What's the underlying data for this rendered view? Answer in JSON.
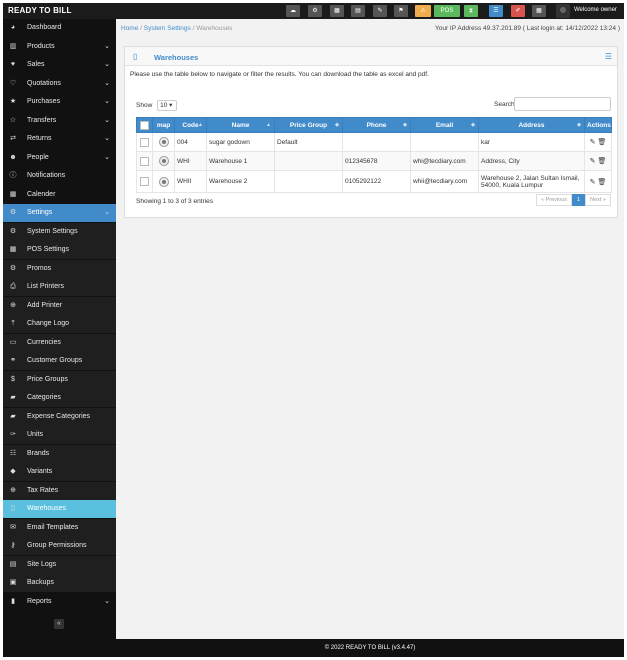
{
  "app": {
    "brand": "READY TO BILL"
  },
  "topbar": {
    "pos_label": "POS",
    "welcome": "Welcome owner",
    "buttons": [
      {
        "icon": "cloud-icon",
        "color": "#555555",
        "glyph": "☁"
      },
      {
        "icon": "gears-icon",
        "color": "#555555",
        "glyph": "⚙"
      },
      {
        "icon": "calculator-icon",
        "color": "#555555",
        "glyph": "▦"
      },
      {
        "icon": "calendar-icon",
        "color": "#555555",
        "glyph": "▤"
      },
      {
        "icon": "note-icon",
        "color": "#555555",
        "glyph": "✎"
      },
      {
        "icon": "flag-icon",
        "color": "#555555",
        "glyph": "⚑"
      },
      {
        "icon": "alert-icon",
        "color": "#f0ad4e",
        "glyph": "⚠"
      },
      {
        "icon": "hourglass-icon",
        "color": "#5cb85c",
        "glyph": "⧗"
      },
      {
        "icon": "list-icon",
        "color": "#428bca",
        "glyph": "☰"
      },
      {
        "icon": "eraser-icon",
        "color": "#d9534f",
        "glyph": "✐"
      },
      {
        "icon": "grid-icon",
        "color": "#555555",
        "glyph": "▦"
      }
    ]
  },
  "sidebar": {
    "items": [
      {
        "label": "Dashboard",
        "icon": "dashboard-icon",
        "glyph": "◕",
        "chevron": false
      },
      {
        "label": "Products",
        "icon": "barcode-icon",
        "glyph": "▥",
        "chevron": true
      },
      {
        "label": "Sales",
        "icon": "heart-icon",
        "glyph": "♥",
        "chevron": true
      },
      {
        "label": "Quotations",
        "icon": "heart-outline-icon",
        "glyph": "♡",
        "chevron": true
      },
      {
        "label": "Purchases",
        "icon": "star-icon",
        "glyph": "★",
        "chevron": true
      },
      {
        "label": "Transfers",
        "icon": "star-outline-icon",
        "glyph": "☆",
        "chevron": true
      },
      {
        "label": "Returns",
        "icon": "random-icon",
        "glyph": "⇄",
        "chevron": true
      },
      {
        "label": "People",
        "icon": "users-icon",
        "glyph": "☻",
        "chevron": true
      },
      {
        "label": "Notifications",
        "icon": "info-icon",
        "glyph": "ⓘ",
        "chevron": false
      },
      {
        "label": "Calender",
        "icon": "calendar-icon",
        "glyph": "▦",
        "chevron": false
      },
      {
        "label": "Settings",
        "icon": "cog-icon",
        "glyph": "⚙",
        "chevron": true,
        "state": "active-parent"
      },
      {
        "label": "System Settings",
        "icon": "cogs-icon",
        "glyph": "⚙",
        "sub": true
      },
      {
        "label": "POS Settings",
        "icon": "th-large-icon",
        "glyph": "▦",
        "sub": true
      },
      {
        "label": "Promos",
        "icon": "cogs-icon",
        "glyph": "⚙",
        "sub": true
      },
      {
        "label": "List Printers",
        "icon": "print-icon",
        "glyph": "⎙",
        "sub": true
      },
      {
        "label": "Add Printer",
        "icon": "plus-circle-icon",
        "glyph": "⊕",
        "sub": true
      },
      {
        "label": "Change Logo",
        "icon": "upload-icon",
        "glyph": "⤒",
        "sub": true
      },
      {
        "label": "Currencies",
        "icon": "money-icon",
        "glyph": "▭",
        "sub": true
      },
      {
        "label": "Customer Groups",
        "icon": "chain-icon",
        "glyph": "⚭",
        "sub": true
      },
      {
        "label": "Price Groups",
        "icon": "dollar-icon",
        "glyph": "$",
        "sub": true
      },
      {
        "label": "Categories",
        "icon": "folder-open-icon",
        "glyph": "▰",
        "sub": true
      },
      {
        "label": "Expense Categories",
        "icon": "folder-open-icon",
        "glyph": "▰",
        "sub": true
      },
      {
        "label": "Units",
        "icon": "wrench-icon",
        "glyph": "✑",
        "sub": true
      },
      {
        "label": "Brands",
        "icon": "th-list-icon",
        "glyph": "☷",
        "sub": true
      },
      {
        "label": "Variants",
        "icon": "tags-icon",
        "glyph": "◆",
        "sub": true
      },
      {
        "label": "Tax Rates",
        "icon": "plus-circle-icon",
        "glyph": "⊕",
        "sub": true
      },
      {
        "label": "Warehouses",
        "icon": "building-icon",
        "glyph": "▯",
        "sub": true,
        "state": "active"
      },
      {
        "label": "Email Templates",
        "icon": "envelope-icon",
        "glyph": "✉",
        "sub": true
      },
      {
        "label": "Group Permissions",
        "icon": "key-icon",
        "glyph": "⚷",
        "sub": true
      },
      {
        "label": "Site Logs",
        "icon": "file-text-icon",
        "glyph": "▤",
        "sub": true
      },
      {
        "label": "Backups",
        "icon": "database-icon",
        "glyph": "▣",
        "sub": true
      },
      {
        "label": "Reports",
        "icon": "bar-chart-icon",
        "glyph": "▮",
        "chevron": true
      }
    ],
    "collapse_glyph": "«"
  },
  "breadcrumb": {
    "home": "Home",
    "sep": "/",
    "parent": "System Settings",
    "current": "Warehouses"
  },
  "ip_info": "Your IP Address 49.37.201.89 ( Last login at: 14/12/2022 13:24 )",
  "panel": {
    "title": "Warehouses",
    "intro": "Please use the table below to navigate or filter the results. You can download the table as excel and pdf."
  },
  "table": {
    "show_label": "Show",
    "page_size": "10",
    "search_label": "Search",
    "search_value": "",
    "columns": [
      "",
      "map",
      "Code",
      "Name",
      "Price Group",
      "Phone",
      "Email",
      "Address",
      "Actions"
    ],
    "rows": [
      {
        "code": "004",
        "name": "sugar godown",
        "price_group": "Default",
        "phone": "",
        "email": "",
        "address": "kar"
      },
      {
        "code": "WHI",
        "name": "Warehouse 1",
        "price_group": "",
        "phone": "012345678",
        "email": "whi@tecdiary.com",
        "address": "Address, City"
      },
      {
        "code": "WHII",
        "name": "Warehouse 2",
        "price_group": "",
        "phone": "0105292122",
        "email": "whii@tecdiary.com",
        "address": "Warehouse 2, Jalan Sultan Ismail, 54000, Kuala Lumpur"
      }
    ],
    "info": "Showing 1 to 3 of 3 entries",
    "pager": {
      "prev": "« Previous",
      "page": "1",
      "next": "Next »"
    }
  },
  "footer": {
    "text": "© 2022 READY TO BILL (v3.4.47)"
  }
}
